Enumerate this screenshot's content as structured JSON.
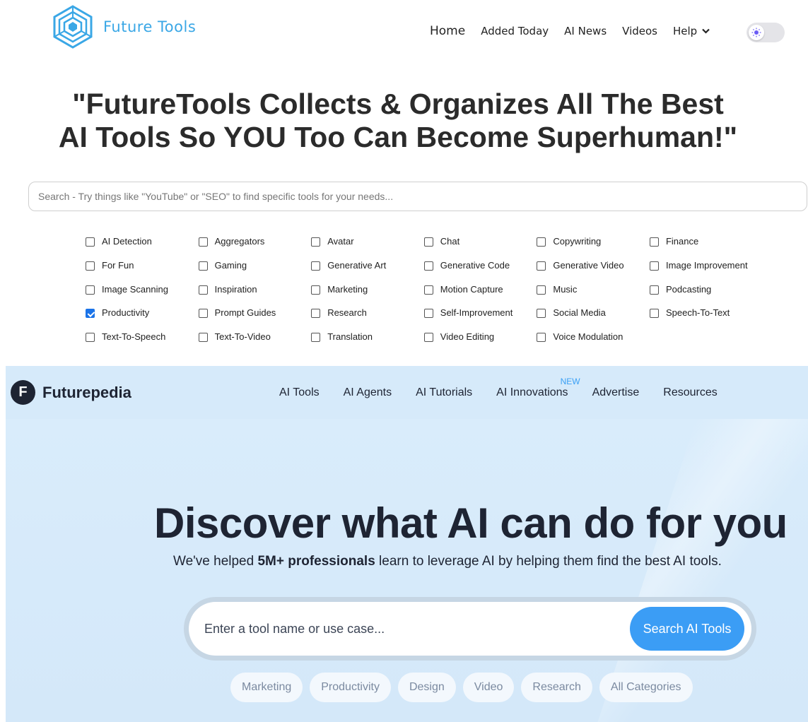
{
  "futuretools": {
    "logo_text": "Future Tools",
    "nav": {
      "home": "Home",
      "added_today": "Added Today",
      "ai_news": "AI News",
      "videos": "Videos",
      "help": "Help"
    },
    "theme_toggle": {
      "icon": "sun-icon",
      "state": "light"
    },
    "headline_line1": "\"FutureTools Collects & Organizes All The Best",
    "headline_line2": "AI Tools So YOU Too Can Become Superhuman!\"",
    "search": {
      "placeholder": "Search - Try things like \"YouTube\" or \"SEO\" to find specific tools for your needs...",
      "value": ""
    },
    "categories": [
      {
        "label": "AI Detection",
        "checked": false
      },
      {
        "label": "Aggregators",
        "checked": false
      },
      {
        "label": "Avatar",
        "checked": false
      },
      {
        "label": "Chat",
        "checked": false
      },
      {
        "label": "Copywriting",
        "checked": false
      },
      {
        "label": "Finance",
        "checked": false
      },
      {
        "label": "For Fun",
        "checked": false
      },
      {
        "label": "Gaming",
        "checked": false
      },
      {
        "label": "Generative Art",
        "checked": false
      },
      {
        "label": "Generative Code",
        "checked": false
      },
      {
        "label": "Generative Video",
        "checked": false
      },
      {
        "label": "Image Improvement",
        "checked": false
      },
      {
        "label": "Image Scanning",
        "checked": false
      },
      {
        "label": "Inspiration",
        "checked": false
      },
      {
        "label": "Marketing",
        "checked": false
      },
      {
        "label": "Motion Capture",
        "checked": false
      },
      {
        "label": "Music",
        "checked": false
      },
      {
        "label": "Podcasting",
        "checked": false
      },
      {
        "label": "Productivity",
        "checked": true
      },
      {
        "label": "Prompt Guides",
        "checked": false
      },
      {
        "label": "Research",
        "checked": false
      },
      {
        "label": "Self-Improvement",
        "checked": false
      },
      {
        "label": "Social Media",
        "checked": false
      },
      {
        "label": "Speech-To-Text",
        "checked": false
      },
      {
        "label": "Text-To-Speech",
        "checked": false
      },
      {
        "label": "Text-To-Video",
        "checked": false
      },
      {
        "label": "Translation",
        "checked": false
      },
      {
        "label": "Video Editing",
        "checked": false
      },
      {
        "label": "Voice Modulation",
        "checked": false
      }
    ],
    "colors": {
      "logo": "#3aa7e6",
      "checkbox_checked": "#1a73e8"
    }
  },
  "futurepedia": {
    "logo_mark": "F",
    "logo_text": "Futurepedia",
    "nav": {
      "ai_tools": "AI Tools",
      "ai_agents": "AI Agents",
      "ai_tutorials": "AI Tutorials",
      "ai_innovations": "AI Innovations",
      "new_badge": "NEW",
      "advertise": "Advertise",
      "resources": "Resources"
    },
    "title": "Discover what AI can do for you",
    "subtitle_before": "We've helped ",
    "subtitle_bold": "5M+ professionals",
    "subtitle_after": " learn to leverage AI by helping them find the best AI tools.",
    "search": {
      "placeholder": "Enter a tool name or use case...",
      "value": "",
      "button": "Search AI Tools"
    },
    "pills": [
      "Marketing",
      "Productivity",
      "Design",
      "Video",
      "Research",
      "All Categories"
    ],
    "colors": {
      "background": "#d9ecfb",
      "button": "#3b9df5",
      "text": "#1e2433",
      "new_badge": "#3aa0f5"
    }
  }
}
